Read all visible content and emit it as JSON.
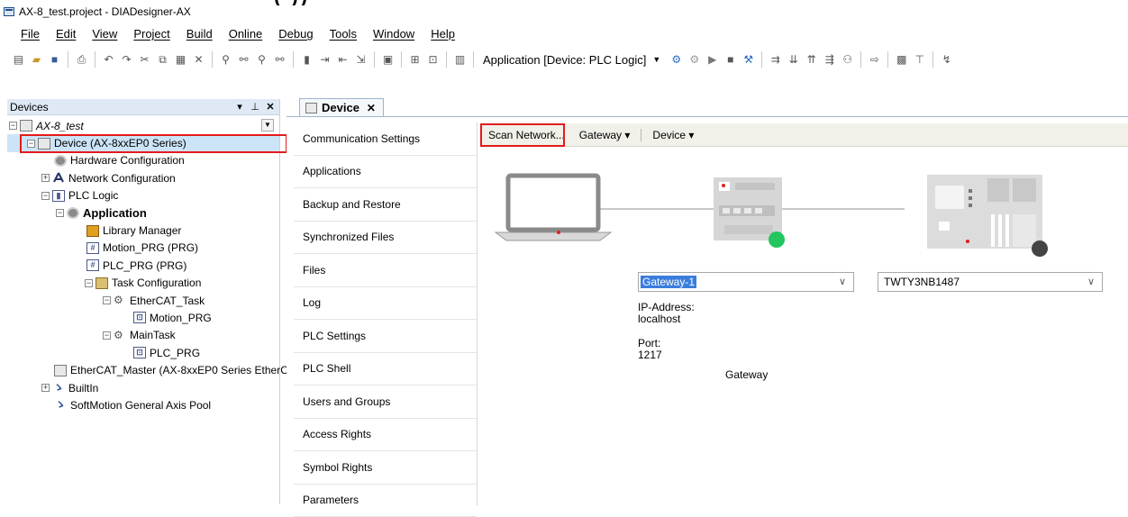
{
  "window": {
    "title": "AX-8_test.project - DIADesigner-AX",
    "truncated_overlay_text": "(   ))"
  },
  "menubar": {
    "items": [
      "File",
      "Edit",
      "View",
      "Project",
      "Build",
      "Online",
      "Debug",
      "Tools",
      "Window",
      "Help"
    ]
  },
  "toolbar": {
    "application_selector": "Application [Device: PLC Logic]"
  },
  "devices_panel": {
    "title": "Devices",
    "header_buttons": [
      "▾",
      "⊥",
      "✕"
    ],
    "tree": [
      {
        "label": "AX-8_test",
        "italic": true
      },
      {
        "label": "Device (AX-8xxEP0 Series)"
      },
      {
        "label": "Hardware Configuration"
      },
      {
        "label": "Network Configuration"
      },
      {
        "label": "PLC Logic"
      },
      {
        "label": "Application",
        "bold": true
      },
      {
        "label": "Library Manager"
      },
      {
        "label": "Motion_PRG (PRG)"
      },
      {
        "label": "PLC_PRG (PRG)"
      },
      {
        "label": "Task Configuration"
      },
      {
        "label": "EtherCAT_Task"
      },
      {
        "label": "Motion_PRG"
      },
      {
        "label": "MainTask"
      },
      {
        "label": "PLC_PRG"
      },
      {
        "label": "EtherCAT_Master (AX-8xxEP0 Series EtherCA"
      },
      {
        "label": "BuiltIn"
      },
      {
        "label": "SoftMotion General Axis Pool"
      }
    ]
  },
  "editor": {
    "tab_label": "Device",
    "tab_close": "✕",
    "nav_items": [
      "Communication Settings",
      "Applications",
      "Backup and Restore",
      "Synchronized Files",
      "Files",
      "Log",
      "PLC Settings",
      "PLC Shell",
      "Users and Groups",
      "Access Rights",
      "Symbol Rights",
      "Parameters"
    ],
    "content_toolbar": {
      "scan_network": "Scan Network...",
      "gateway": "Gateway ▾",
      "device": "Device ▾"
    },
    "gateway": {
      "label": "Gateway",
      "selected": "Gateway-1",
      "ip_label": "IP-Address:",
      "ip_value": "localhost",
      "port_label": "Port:",
      "port_value": "1217",
      "status_color": "#22c55e"
    },
    "device": {
      "selected": "TWTY3NB1487",
      "status_color": "#444444"
    }
  },
  "colors": {
    "highlight": "#e21b1b",
    "selection": "#cce4f7",
    "panel_header": "#dfe9f5"
  }
}
